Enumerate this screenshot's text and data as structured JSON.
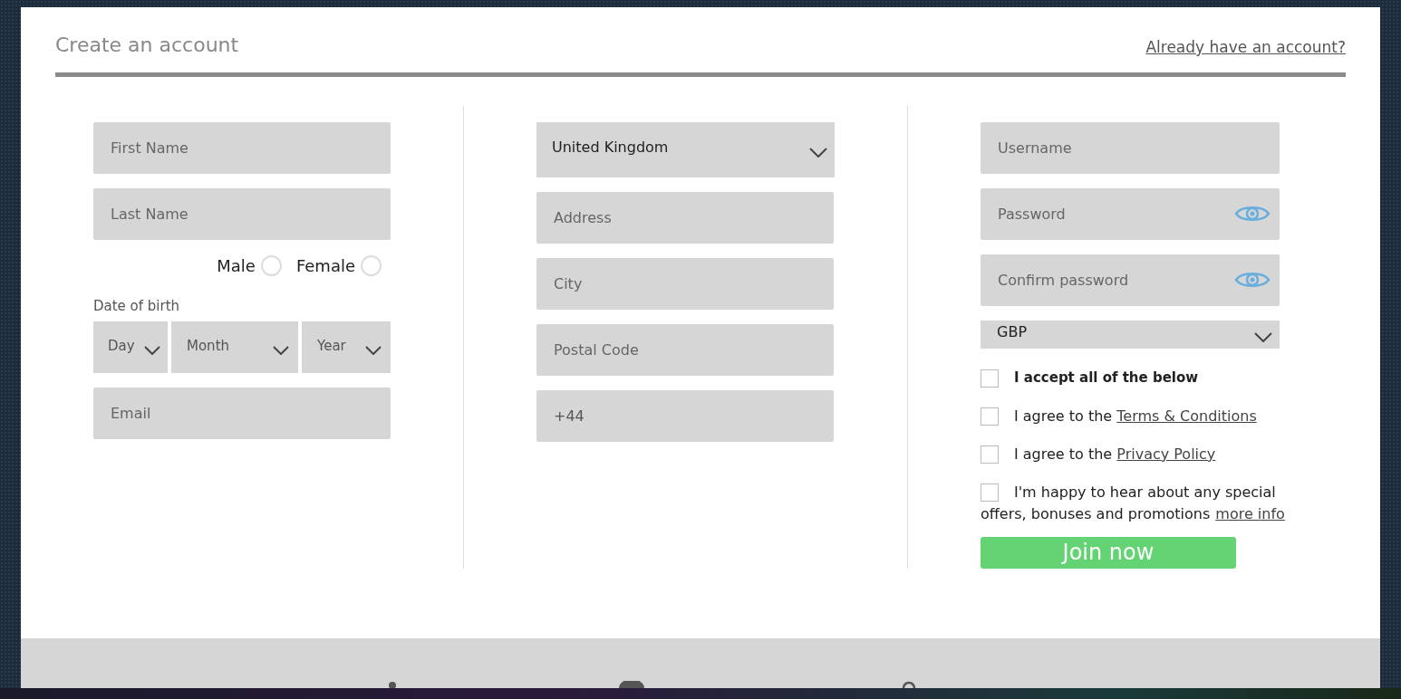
{
  "header": {
    "title": "Create an account",
    "login_link": "Already have an account?"
  },
  "personal": {
    "first_name": {
      "placeholder": "First Name"
    },
    "last_name": {
      "placeholder": "Last Name"
    },
    "gender": [
      {
        "label": "Male",
        "selected": false
      },
      {
        "label": "Female",
        "selected": false
      }
    ],
    "dob_label": "Date of birth",
    "dob": [
      {
        "value": "Day"
      },
      {
        "value": "Month"
      },
      {
        "value": "Year"
      }
    ],
    "email": {
      "placeholder": "Email"
    }
  },
  "address": {
    "country": {
      "value": "United Kingdom"
    },
    "fields": [
      {
        "placeholder": "Address"
      },
      {
        "placeholder": "City"
      },
      {
        "placeholder": "Postal Code"
      }
    ],
    "phone": {
      "value": "+44"
    }
  },
  "account": {
    "fields": [
      {
        "kind": "text",
        "placeholder": "Username"
      },
      {
        "kind": "password",
        "placeholder": "Password"
      },
      {
        "kind": "password",
        "placeholder": "Confirm password"
      }
    ],
    "currency": {
      "value": "GBP"
    },
    "consents": [
      {
        "kind": "master",
        "text": "I accept all of the below",
        "checked": false
      },
      {
        "kind": "link",
        "text": "I agree to the",
        "link": "Terms & Conditions",
        "checked": false
      },
      {
        "kind": "link",
        "text": "I agree to the",
        "link": "Privacy Policy",
        "checked": false
      },
      {
        "kind": "wrap",
        "text": "I'm happy to hear about any special",
        "text_2": "offers, bonuses and promotions",
        "link": "more info",
        "checked": false
      }
    ],
    "submit": "Join now"
  }
}
